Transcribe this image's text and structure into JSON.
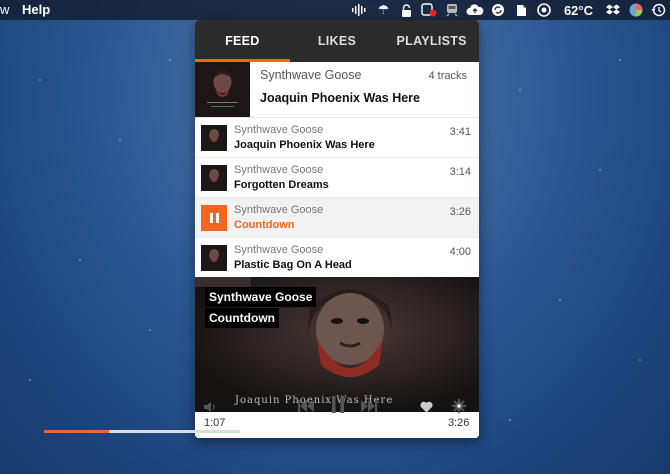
{
  "menubar": {
    "partial_left": "w",
    "help": "Help",
    "temperature": "62°C"
  },
  "tabs": [
    {
      "label": "FEED",
      "active": true
    },
    {
      "label": "LIKES",
      "active": false
    },
    {
      "label": "PLAYLISTS",
      "active": false
    }
  ],
  "album": {
    "artist": "Synthwave Goose",
    "title": "Joaquin Phoenix Was Here",
    "track_count": "4 tracks"
  },
  "tracks": [
    {
      "artist": "Synthwave Goose",
      "title": "Joaquin Phoenix Was Here",
      "duration": "3:41"
    },
    {
      "artist": "Synthwave Goose",
      "title": "Forgotten Dreams",
      "duration": "3:14"
    },
    {
      "artist": "Synthwave Goose",
      "title": "Countdown",
      "duration": "3:26",
      "playing": true
    },
    {
      "artist": "Synthwave Goose",
      "title": "Plastic Bag On A Head",
      "duration": "4:00"
    }
  ],
  "now_playing": {
    "artist": "Synthwave Goose",
    "title": "Countdown",
    "cover_caption": "Joaquin Phoenix Was Here"
  },
  "player": {
    "elapsed": "1:07",
    "total": "3:26",
    "progress": 0.33
  },
  "colors": {
    "accent": "#f26522",
    "tabbar": "#2b2b2b"
  }
}
